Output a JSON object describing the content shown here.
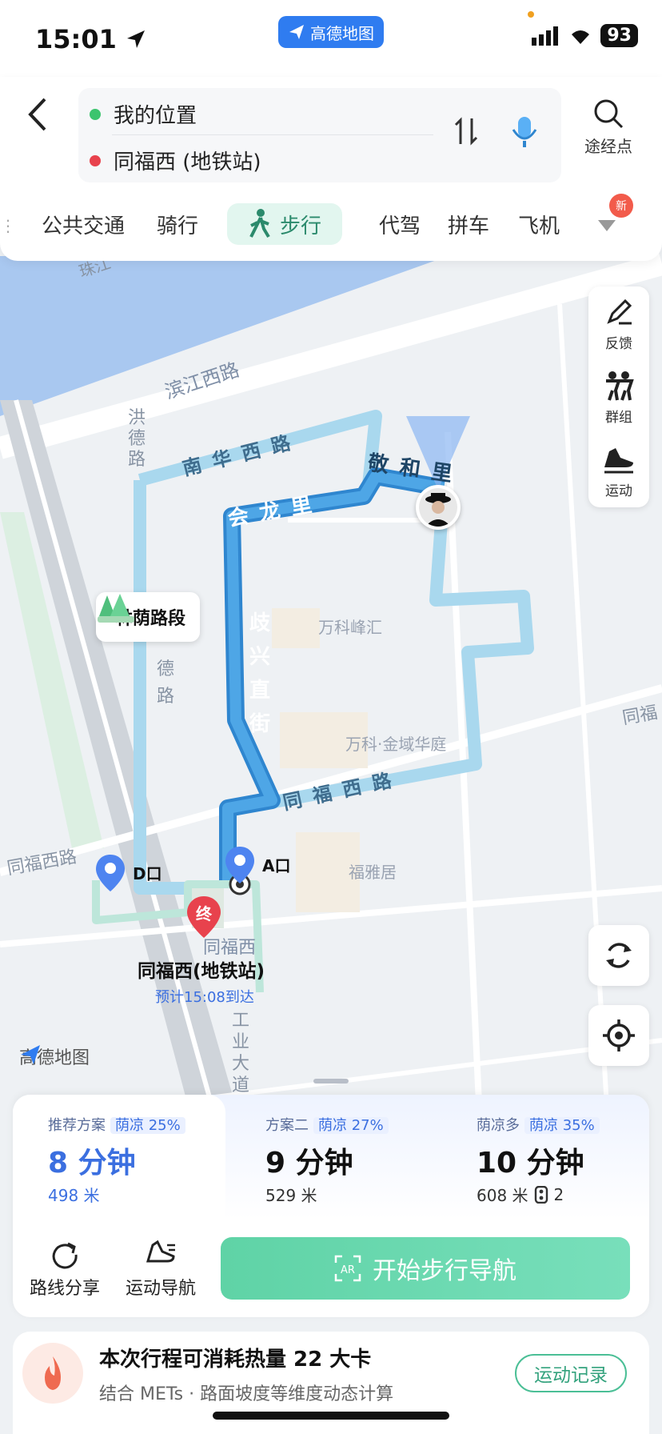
{
  "status": {
    "time": "15:01",
    "app_badge": "高德地图",
    "battery": "93"
  },
  "route": {
    "origin": "我的位置",
    "destination": "同福西 (地铁站)",
    "waypoint_label": "途经点"
  },
  "tabs": [
    {
      "label": "公共交通"
    },
    {
      "label": "骑行"
    },
    {
      "label": "步行",
      "selected": true
    },
    {
      "label": "代驾"
    },
    {
      "label": "拼车"
    },
    {
      "label": "飞机"
    }
  ],
  "new_badge": "新",
  "map": {
    "roads": {
      "binjiang": "滨江西路",
      "nanhua": "南华西路",
      "huilong": "会龙里",
      "jinghe": "敬和里",
      "qixing": "歧兴直街",
      "tongfu": "同福西路",
      "hongde": "洪德路",
      "de_lu": "德路",
      "tongfu_left": "同福西路",
      "tongfu_right": "同福",
      "zhujiang": "珠江",
      "gongye": "工业大道北"
    },
    "pois": {
      "wanke_fenghui": "万科峰汇",
      "wanke_jinyu": "万科·金域华庭",
      "fuya": "福雅居"
    },
    "shade_tag": "林荫路段",
    "exit_d": "D口",
    "exit_a": "A口",
    "end_marker": "终",
    "station_small": "同福西",
    "station_name": "同福西(地铁站)",
    "eta": "预计15:08到达",
    "watermark": "高德地图"
  },
  "side_tools": {
    "feedback": "反馈",
    "group": "群组",
    "sport": "运动"
  },
  "plans": [
    {
      "title": "推荐方案",
      "cool": "荫凉 25%",
      "time": "8 分钟",
      "distance": "498 米",
      "selected": true
    },
    {
      "title": "方案二",
      "cool": "荫凉 27%",
      "time": "9 分钟",
      "distance": "529 米"
    },
    {
      "title": "荫凉多",
      "cool": "荫凉 35%",
      "time": "10 分钟",
      "distance": "608 米",
      "lights": "2"
    }
  ],
  "actions": {
    "share": "路线分享",
    "sport_nav": "运动导航",
    "start": "开始步行导航"
  },
  "calorie": {
    "title": "本次行程可消耗热量 22 大卡",
    "subtitle": "结合 METs · 路面坡度等维度动态计算",
    "record": "运动记录"
  },
  "colors": {
    "accent": "#2f7cf0",
    "route_main": "#3a8fd8",
    "route_alt": "#a9d8ee",
    "start_btn": "#5fd3a6"
  }
}
